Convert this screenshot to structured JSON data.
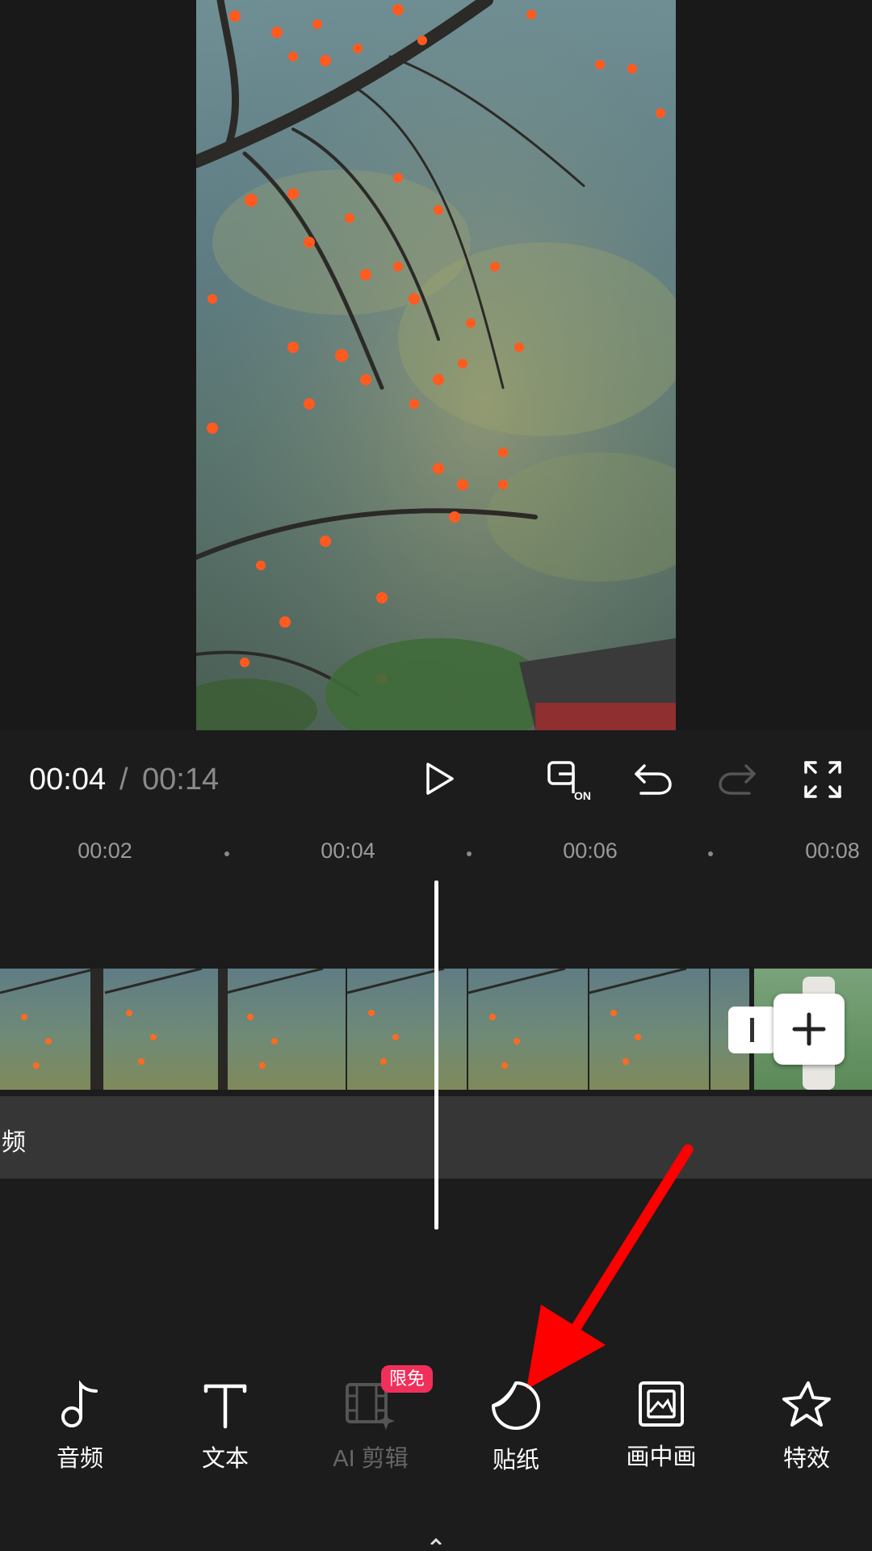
{
  "player": {
    "current_time": "00:04",
    "separator": "/",
    "total_time": "00:14"
  },
  "timeline": {
    "ticks": [
      "00:02",
      "00:04",
      "00:06",
      "00:08"
    ],
    "audio_track_label": "频"
  },
  "toolbar": {
    "items": [
      {
        "label": "音频",
        "icon": "music-note-icon"
      },
      {
        "label": "文本",
        "icon": "text-icon"
      },
      {
        "label": "AI 剪辑",
        "icon": "ai-edit-icon"
      },
      {
        "label": "贴纸",
        "icon": "sticker-icon"
      },
      {
        "label": "画中画",
        "icon": "picture-in-picture-icon"
      },
      {
        "label": "特效",
        "icon": "effects-star-icon"
      }
    ],
    "badge": "限免"
  },
  "annotation": {
    "arrow_color": "#ff0000"
  },
  "colors": {
    "background": "#1c1c1c",
    "badge": "#f0305a",
    "disabled": "#666666"
  }
}
